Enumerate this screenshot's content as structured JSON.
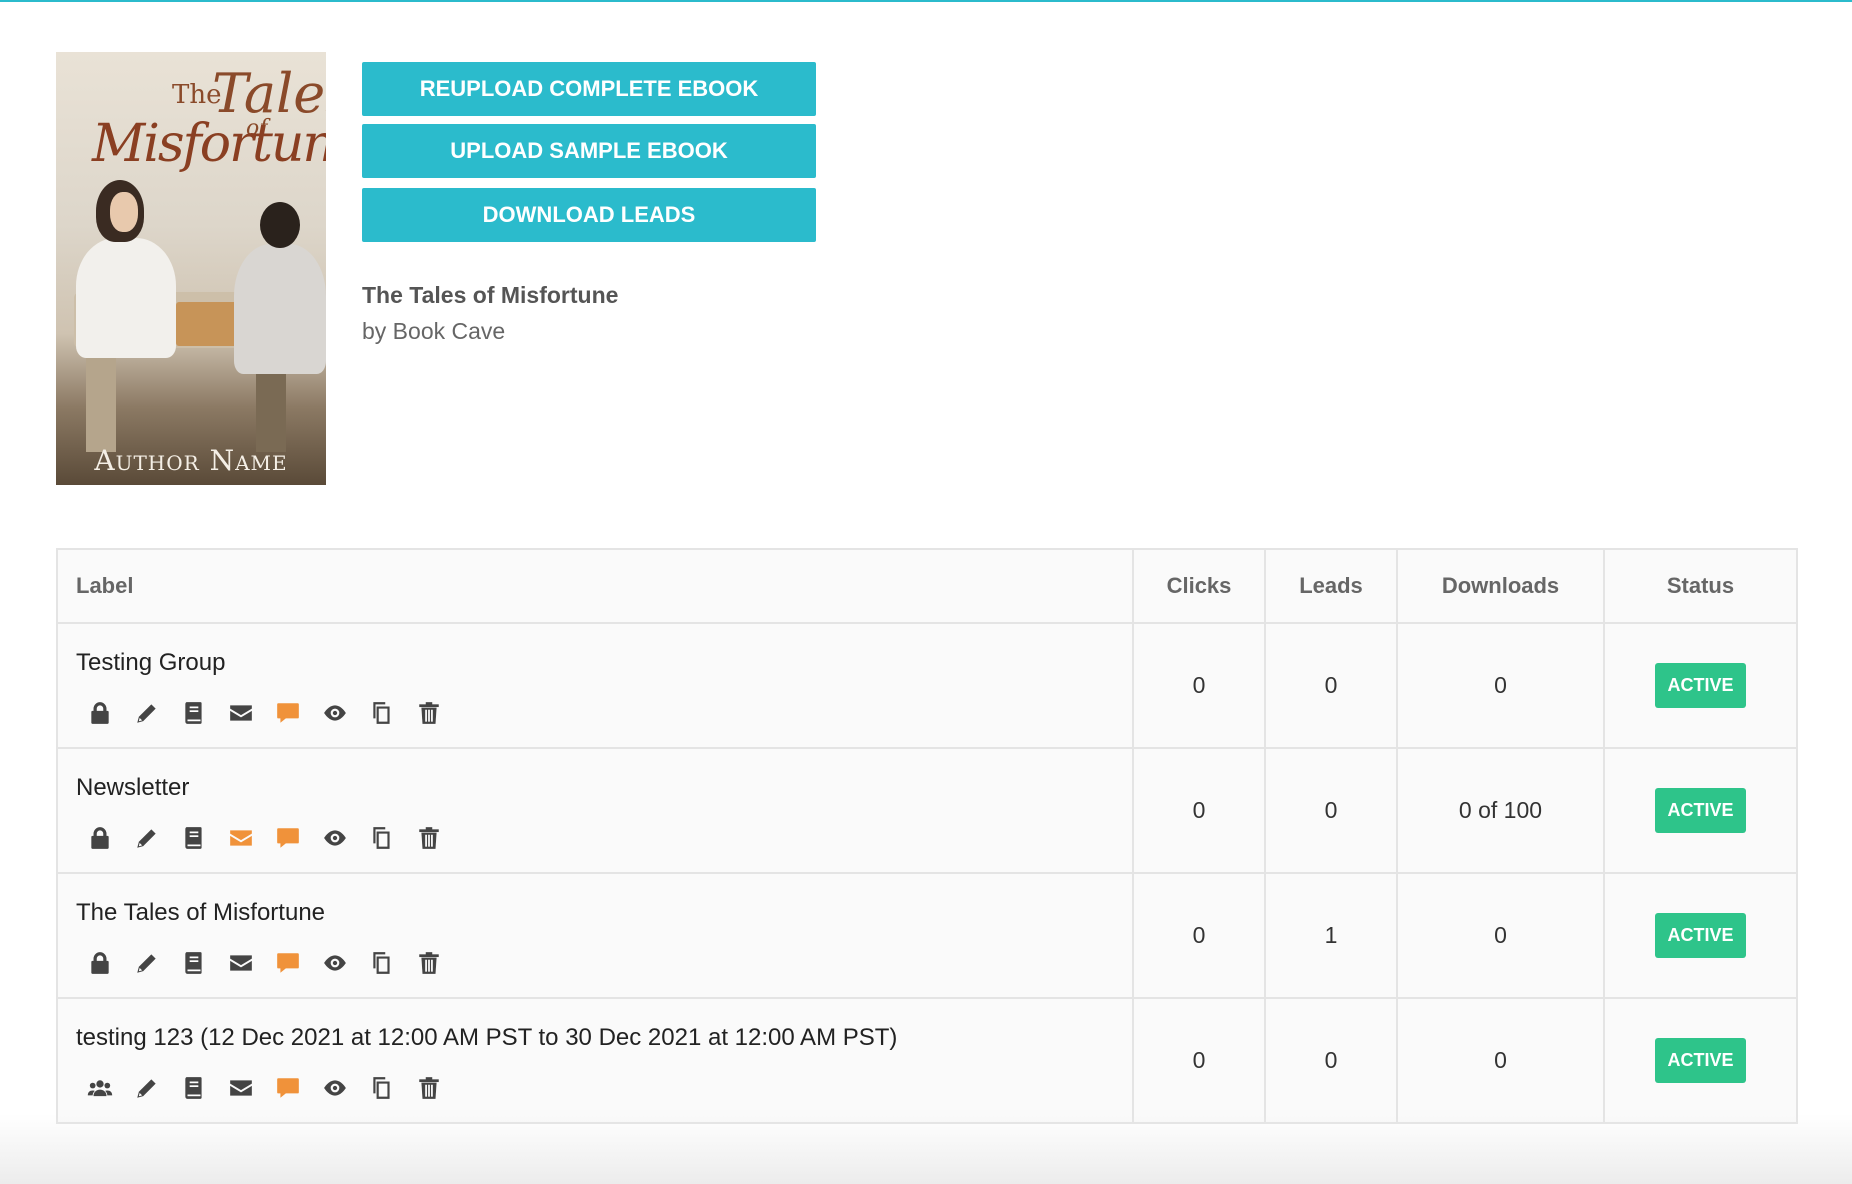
{
  "cover": {
    "title_the": "The",
    "title_tales": "Tales",
    "title_of": "of",
    "title_misfortune": "Misfortune",
    "author_name": "Author Name"
  },
  "actions": {
    "reupload_label": "REUPLOAD COMPLETE EBOOK",
    "upload_sample_label": "UPLOAD SAMPLE EBOOK",
    "download_leads_label": "DOWNLOAD LEADS"
  },
  "book": {
    "title": "The Tales of Misfortune",
    "byline": "by Book Cave"
  },
  "table": {
    "headers": {
      "label": "Label",
      "clicks": "Clicks",
      "leads": "Leads",
      "downloads": "Downloads",
      "status": "Status"
    },
    "rows": [
      {
        "label": "Testing Group",
        "clicks": "0",
        "leads": "0",
        "downloads": "0",
        "status": "ACTIVE",
        "first_icon": "lock-icon",
        "email_highlight": false
      },
      {
        "label": "Newsletter",
        "clicks": "0",
        "leads": "0",
        "downloads": "0 of 100",
        "status": "ACTIVE",
        "first_icon": "lock-icon",
        "email_highlight": true
      },
      {
        "label": "The Tales of Misfortune",
        "clicks": "0",
        "leads": "1",
        "downloads": "0",
        "status": "ACTIVE",
        "first_icon": "lock-icon",
        "email_highlight": false
      },
      {
        "label": "testing 123 (12 Dec 2021 at 12:00 AM PST to 30 Dec 2021 at 12:00 AM PST)",
        "clicks": "0",
        "leads": "0",
        "downloads": "0",
        "status": "ACTIVE",
        "first_icon": "users-icon",
        "email_highlight": false
      }
    ]
  },
  "colors": {
    "accent": "#2bbbcc",
    "active_badge": "#2ec48a",
    "icon_default": "#444444",
    "icon_highlight": "#f0923a"
  }
}
